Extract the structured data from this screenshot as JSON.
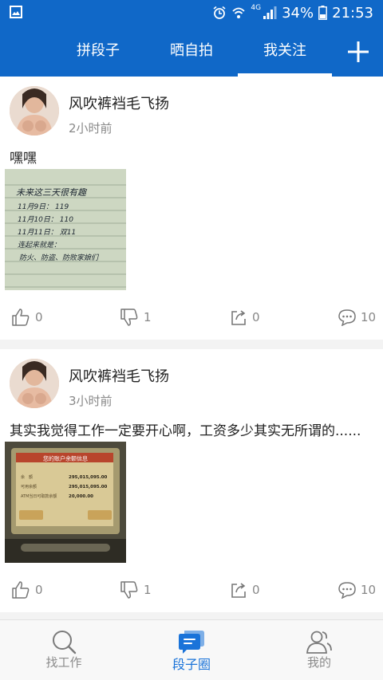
{
  "status_bar": {
    "gallery_icon": "image-icon",
    "icons": [
      "alarm-icon",
      "wifi-icon",
      "signal-icon",
      "battery-icon"
    ],
    "network": "4G",
    "battery": "34%",
    "time": "21:53"
  },
  "top_nav": {
    "tabs": [
      {
        "label": "拼段子",
        "active": false
      },
      {
        "label": "晒自拍",
        "active": false
      },
      {
        "label": "我关注",
        "active": true
      }
    ],
    "plus_icon": "plus-icon",
    "background": "#1068c8"
  },
  "posts": [
    {
      "author": "风吹裤裆毛飞扬",
      "time": "2小时前",
      "text": "嘿嘿",
      "image": {
        "handwriting": [
          "未来这三天很有趣",
          "11月9日： 119",
          "11月10日： 110",
          "11月11日： 双11",
          "连起来就是：",
          "防火、防盗、防败家娘们"
        ]
      },
      "likes": "0",
      "dislikes": "1",
      "shares": "0",
      "comments": "10"
    },
    {
      "author": "风吹裤裆毛飞扬",
      "time": "3小时前",
      "text": "其实我觉得工作一定要开心啊，工资多少其实无所谓的......",
      "image": {
        "screen_title": "您的账户余额信息",
        "rows": [
          {
            "label": "余　额",
            "value": "295,015,095.00"
          },
          {
            "label": "可用余额",
            "value": "295,015,095.00"
          },
          {
            "label": "ATM当日可取款余额",
            "value": "20,000.00"
          }
        ]
      },
      "likes": "0",
      "dislikes": "1",
      "shares": "0",
      "comments": "10"
    }
  ],
  "bottom_nav": [
    {
      "label": "找工作",
      "icon": "search-icon",
      "active": false
    },
    {
      "label": "段子圈",
      "icon": "chat-bubble-icon",
      "active": true
    },
    {
      "label": "我的",
      "icon": "user-icon",
      "active": false
    }
  ],
  "accent_color": "#1a73d9"
}
